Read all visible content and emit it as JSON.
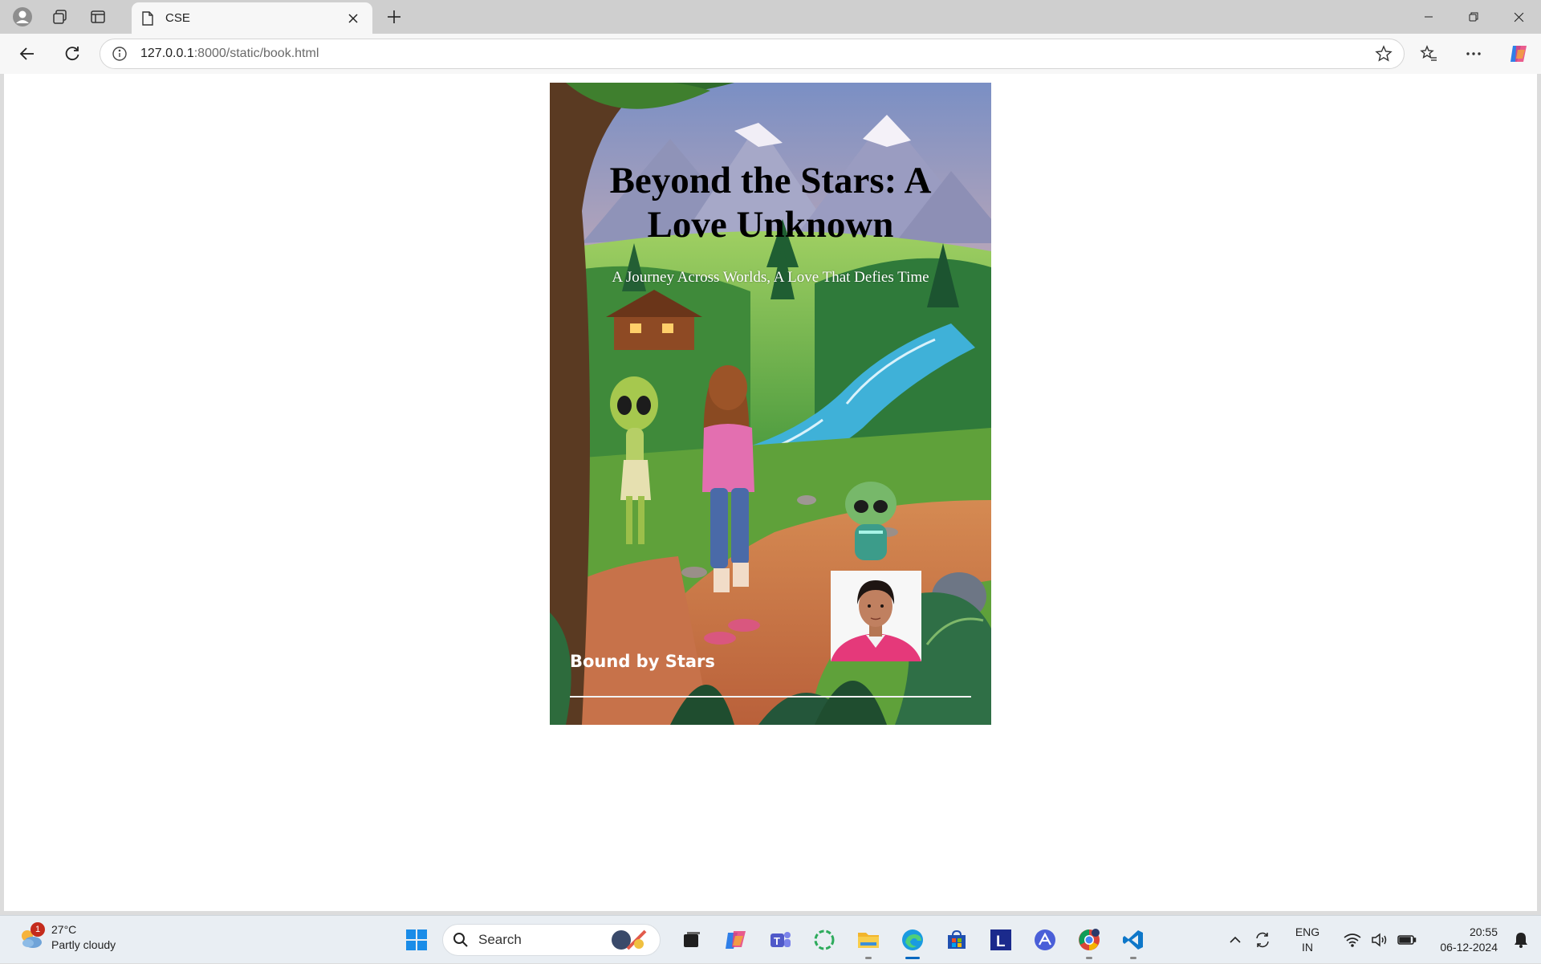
{
  "browser": {
    "tab": {
      "title": "CSE"
    },
    "address": {
      "host": "127.0.0.1",
      "path": ":8000/static/book.html"
    }
  },
  "book": {
    "title": "Beyond the Stars: A Love Unknown",
    "subtitle": "A Journey Across Worlds, A Love That Defies Time",
    "author": "Bound by Stars"
  },
  "taskbar": {
    "weather": {
      "temp": "27°C",
      "condition": "Partly cloudy",
      "alerts": "1"
    },
    "search_label": "Search",
    "lang_top": "ENG",
    "lang_bottom": "IN",
    "time": "20:55",
    "date": "06-12-2024"
  },
  "colors": {
    "accent": "#0067c0",
    "author_shirt": "#e5397a",
    "river": "#3fb1d8"
  }
}
